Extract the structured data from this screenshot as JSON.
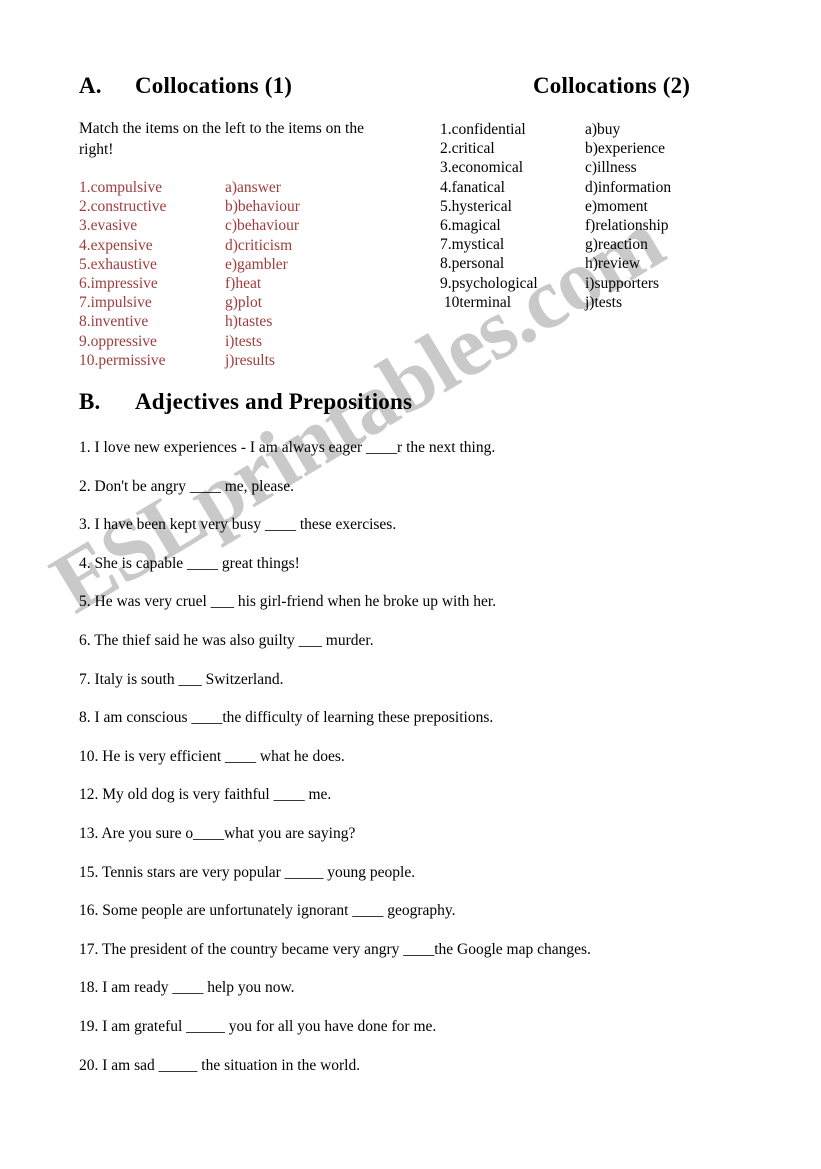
{
  "watermark": {
    "text": "ESLprintables.com",
    "color": "#c9c9c9"
  },
  "colors": {
    "list_a_text": "#a03c3c",
    "list_b_text": "#000000",
    "heading": "#000000"
  },
  "sections": {
    "a": {
      "letter": "A.",
      "title": "Collocations (1)",
      "instructions": "Match the items on the left to the items on the right!",
      "items": [
        "1.compulsive",
        "2.constructive",
        "3.evasive",
        "4.expensive",
        "5.exhaustive",
        "6.impressive",
        "7.impulsive",
        "8.inventive",
        "9.oppressive",
        "10.permissive"
      ],
      "options": [
        "a)answer",
        "b)behaviour",
        "c)behaviour",
        "d)criticism",
        "e)gambler",
        "f)heat",
        "g)plot",
        "h)tastes",
        "i)tests",
        "j)results"
      ]
    },
    "c": {
      "title": "Collocations (2)",
      "items": [
        "1.confidential",
        "2.critical",
        "3.economical",
        "4.fanatical",
        "5.hysterical",
        "6.magical",
        "7.mystical",
        "8.personal",
        "9.psychological",
        " 10terminal"
      ],
      "options": [
        "a)buy",
        "b)experience",
        "c)illness",
        "d)information",
        "e)moment",
        "f)relationship",
        "g)reaction",
        "h)review",
        "i)supporters",
        "j)tests"
      ]
    },
    "b": {
      "letter": "B.",
      "title": "Adjectives and Prepositions",
      "questions": [
        "1. I love new experiences - I am always eager ____r the next thing.",
        "2. Don't be angry ____ me, please.",
        "3. I have been kept very busy ____ these exercises.",
        "4. She is capable ____ great things!",
        "5. He was very cruel ___ his girl-friend when he broke up with her.",
        "6. The thief said he was also guilty ___ murder.",
        "7. Italy is south ___ Switzerland.",
        "8. I am conscious ____the difficulty of learning these prepositions.",
        "10. He is very efficient ____ what he does.",
        "12. My old dog is very faithful ____ me.",
        "13. Are you sure o____what you are saying?",
        "15. Tennis stars are very popular _____ young people.",
        "16. Some people are unfortunately ignorant ____ geography.",
        "17. The president of the country became very angry ____the Google map changes.",
        "18. I am ready ____ help you now.",
        "19. I am grateful _____ you for all you have done for me.",
        "20. I am sad _____ the situation in the world."
      ]
    }
  }
}
